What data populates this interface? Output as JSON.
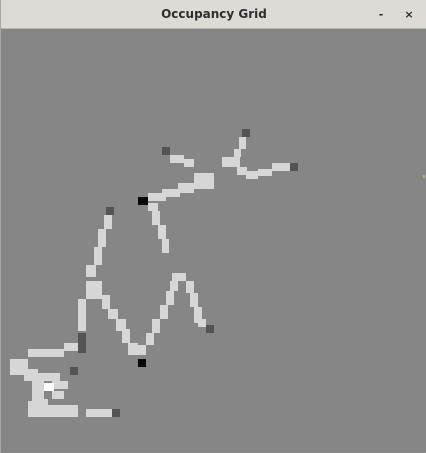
{
  "window": {
    "title": "Occupancy Grid",
    "minimize_label": "-",
    "close_label": "×"
  },
  "grid": {
    "colors": {
      "unknown": "#868686",
      "free": "#d6d6d6",
      "wall": "#545454",
      "dark": "#090909",
      "white": "#ffffff"
    },
    "cells": [
      [
        8,
        34,
        7,
        44,
        6
      ],
      [
        13,
        48,
        7,
        57,
        3
      ],
      [
        20,
        64,
        8,
        65,
        2
      ],
      [
        20,
        74,
        7,
        81,
        5
      ],
      [
        16,
        84,
        2,
        92,
        3
      ],
      [
        24,
        95,
        9,
        97,
        4
      ],
      [
        24,
        106,
        10,
        111,
        3
      ],
      [
        26,
        115,
        16,
        121,
        1
      ],
      [
        26,
        130,
        23,
        132,
        5
      ],
      [
        32,
        138,
        27,
        139,
        5
      ],
      [
        36,
        145,
        33,
        149,
        7
      ],
      [
        39,
        164,
        23,
        167,
        8
      ],
      [
        37,
        178,
        32,
        184,
        2
      ],
      [
        37,
        193,
        27,
        199,
        5
      ],
      [
        37,
        233,
        33,
        240,
        4
      ],
      [
        37,
        247,
        28,
        255,
        5
      ],
      [
        37,
        263,
        23,
        269,
        7
      ],
      [
        37,
        279,
        27,
        286,
        2
      ],
      [
        51,
        285,
        21,
        292,
        3
      ],
      [
        12,
        165,
        3,
        170,
        3
      ]
    ]
  }
}
